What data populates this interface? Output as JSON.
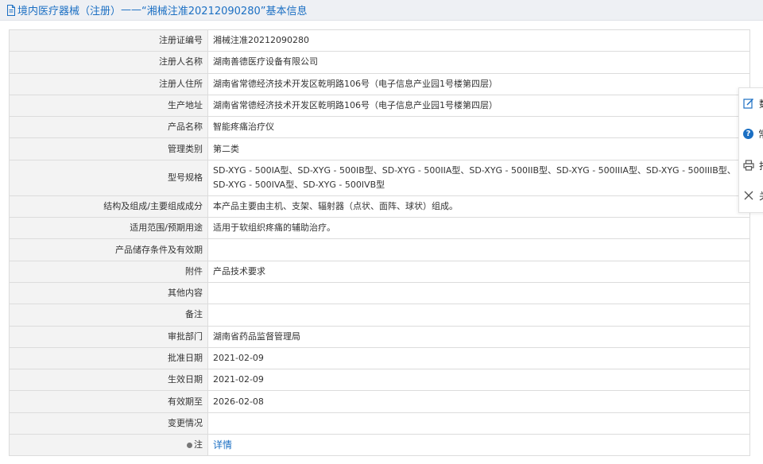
{
  "header": {
    "prefix": "境内医疗器械（注册）",
    "separator": " —— ",
    "title": "“湘械注准20212090280”基本信息"
  },
  "rows": [
    {
      "label": "注册证编号",
      "value": "湘械注准20212090280"
    },
    {
      "label": "注册人名称",
      "value": "湖南善德医疗设备有限公司"
    },
    {
      "label": "注册人住所",
      "value": "湖南省常德经济技术开发区乾明路106号（电子信息产业园1号楼第四层）"
    },
    {
      "label": "生产地址",
      "value": "湖南省常德经济技术开发区乾明路106号（电子信息产业园1号楼第四层）"
    },
    {
      "label": "产品名称",
      "value": "智能疼痛治疗仪"
    },
    {
      "label": "管理类别",
      "value": "第二类"
    },
    {
      "label": "型号规格",
      "value": "SD-XYG - 500IA型、SD-XYG - 500IB型、SD-XYG - 500IIA型、SD-XYG - 500IIB型、SD-XYG - 500IIIA型、SD-XYG - 500IIIB型、SD-XYG - 500IVA型、SD-XYG - 500IVB型"
    },
    {
      "label": "结构及组成/主要组成成分",
      "value": "本产品主要由主机、支架、辐射器（点状、面阵、球状）组成。"
    },
    {
      "label": "适用范围/预期用途",
      "value": "适用于软组织疼痛的辅助治疗。"
    },
    {
      "label": "产品储存条件及有效期",
      "value": ""
    },
    {
      "label": "附件",
      "value": "产品技术要求"
    },
    {
      "label": "其他内容",
      "value": ""
    },
    {
      "label": "备注",
      "value": ""
    },
    {
      "label": "审批部门",
      "value": "湖南省药品监督管理局"
    },
    {
      "label": "批准日期",
      "value": "2021-02-09"
    },
    {
      "label": "生效日期",
      "value": "2021-02-09"
    },
    {
      "label": "有效期至",
      "value": "2026-02-08"
    },
    {
      "label": "变更情况",
      "value": ""
    }
  ],
  "note_row": {
    "label": "注",
    "link": "详情",
    "icon": "note-icon"
  },
  "side_toolbar": [
    {
      "icon": "edit-icon",
      "label": "数"
    },
    {
      "icon": "help-icon",
      "label": "常"
    },
    {
      "icon": "print-icon",
      "label": "打"
    },
    {
      "icon": "close-icon",
      "label": "关"
    }
  ],
  "colors": {
    "link": "#1b6fc3",
    "label_bg": "#f3f3f3",
    "border": "#dcdcdc",
    "header_bg": "#eef0f4"
  }
}
